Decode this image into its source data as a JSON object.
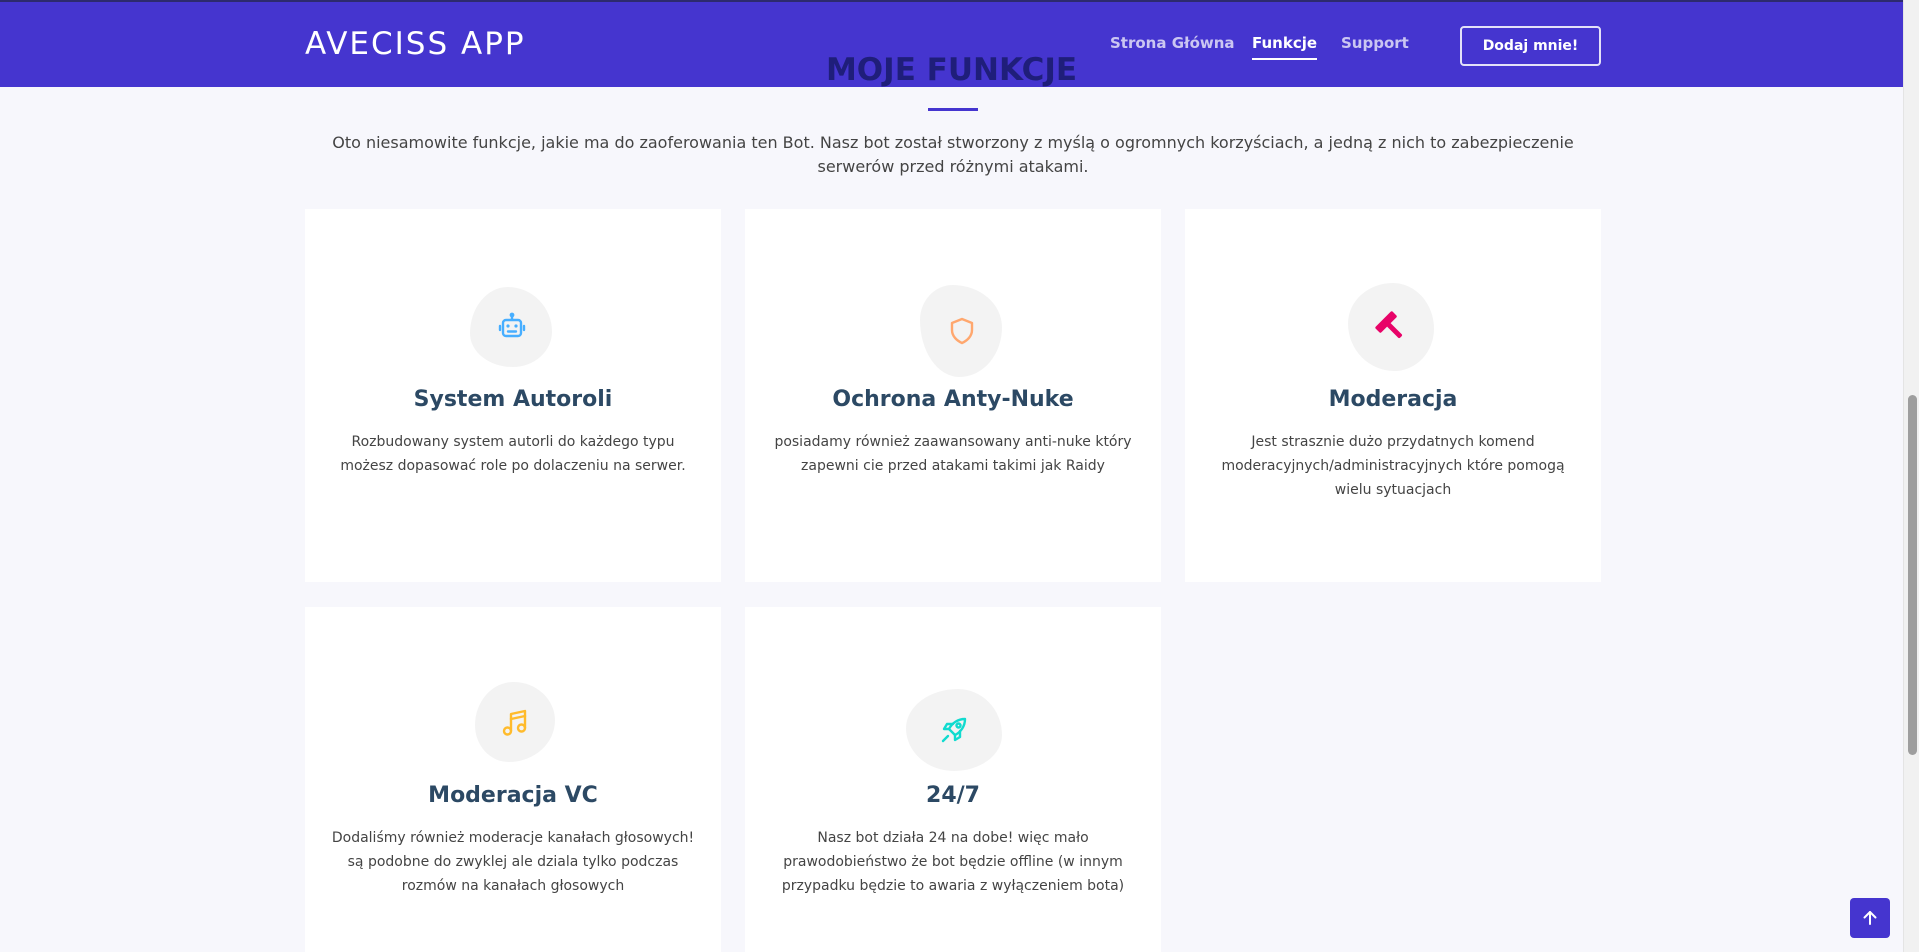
{
  "header": {
    "brand": "AVECISS APP",
    "nav": [
      {
        "label": "Strona Główna",
        "active": false
      },
      {
        "label": "Funkcje",
        "active": true
      },
      {
        "label": "Support",
        "active": false
      }
    ],
    "cta_label": "Dodaj mnie!"
  },
  "section": {
    "title": "MOJE FUNKCJE",
    "intro": "Oto niesamowite funkcje, jakie ma do zaoferowania ten Bot. Nasz bot został stworzony z myślą o ogromnych korzyściach, a jedną z nich to zabezpieczenie serwerów przed różnymi atakami."
  },
  "features": [
    {
      "icon": "robot-icon",
      "color": "#47aeff",
      "title": "System Autoroli",
      "text": "Rozbudowany system autorli do każdego typu możesz dopasować role po dolaczeniu na serwer."
    },
    {
      "icon": "shield-icon",
      "color": "#ffa76e",
      "title": "Ochrona Anty-Nuke",
      "text": "posiadamy również zaawansowany anti-nuke który zapewni cie przed atakami takimi jak Raidy"
    },
    {
      "icon": "hammer-icon",
      "color": "#e80368",
      "title": "Moderacja",
      "text": "Jest strasznie dużo przydatnych komend moderacyjnych/administracyjnych które pomogą wielu sytuacjach"
    },
    {
      "icon": "music-icon",
      "color": "#ffbb2c",
      "title": "Moderacja VC",
      "text": "Dodaliśmy również moderacje kanałach głosowych! są podobne do zwyklej ale dziala tylko podczas rozmów na kanałach głosowych"
    },
    {
      "icon": "rocket-icon",
      "color": "#11dbcf",
      "title": "24/7",
      "text": "Nasz bot działa 24 na dobe! więc mało prawodobieństwo że bot będzie offline (w innym przypadku będzie to awaria z wyłączeniem bota)"
    }
  ],
  "colors": {
    "primary": "#4535cf",
    "heading": "#1f1e7a",
    "card_title": "#2c4964"
  }
}
